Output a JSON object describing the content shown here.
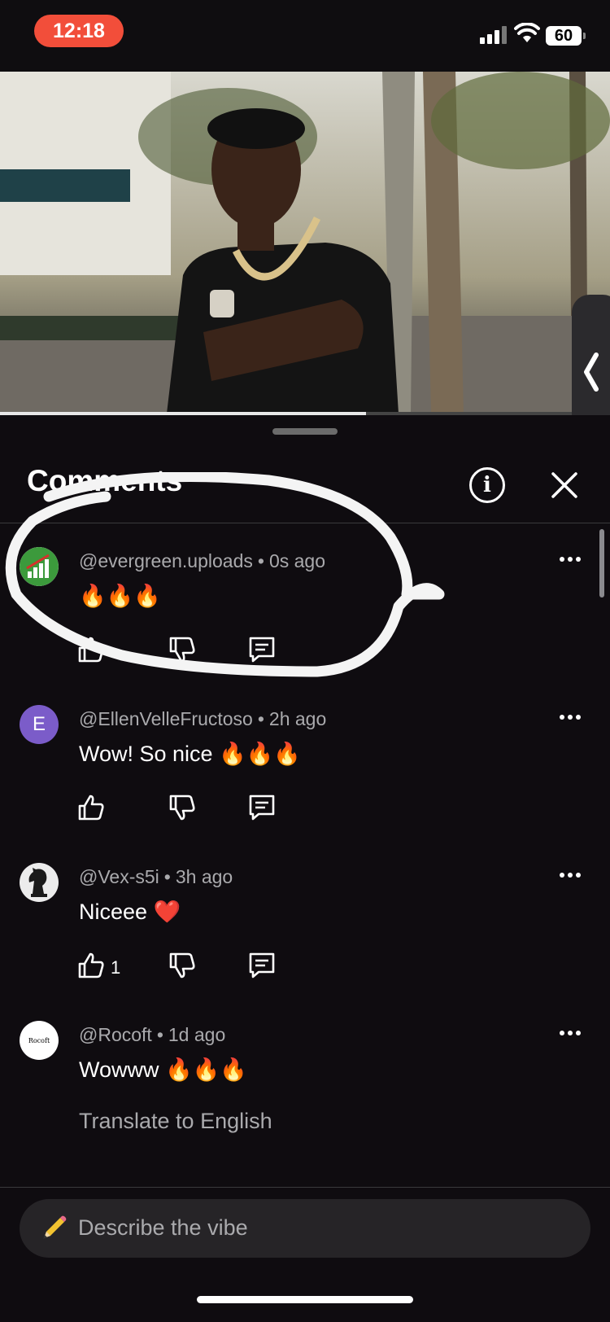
{
  "status": {
    "time": "12:18",
    "battery": "60"
  },
  "video": {
    "progress": 0.6
  },
  "comments_sheet": {
    "title": "Comments",
    "comments": [
      {
        "user": "@evergreen.uploads",
        "age": "0s ago",
        "text": "🔥🔥🔥",
        "avatar": "chart-logo",
        "likes": ""
      },
      {
        "user": "@EllenVelleFructoso",
        "age": "2h ago",
        "text": "Wow! So nice 🔥🔥🔥",
        "avatar_letter": "E",
        "avatar_color": "#7b5cc9",
        "likes": ""
      },
      {
        "user": "@Vex-s5i",
        "age": "3h ago",
        "text": "Niceee ❤️",
        "avatar": "knight-chess-piece",
        "likes": "1"
      },
      {
        "user": "@Rocoft",
        "age": "1d ago",
        "text": "Wowww 🔥🔥🔥",
        "avatar_label": "Rocoft",
        "translate": "Translate to English",
        "likes": ""
      }
    ]
  },
  "composer": {
    "placeholder": "Describe the vibe",
    "icon": "pencil-emoji"
  }
}
